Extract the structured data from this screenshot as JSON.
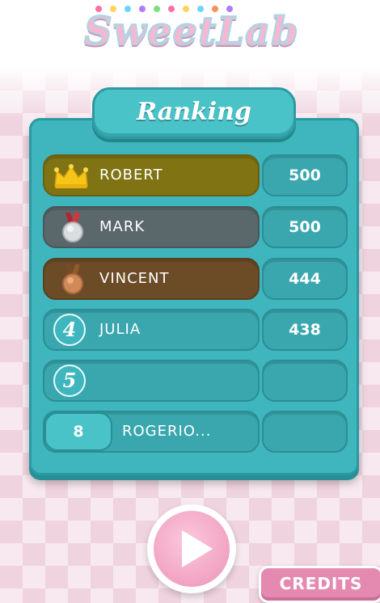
{
  "logo": {
    "text": "SweetLab"
  },
  "ranking": {
    "title": "Ranking",
    "rows": [
      {
        "rank": "1",
        "name": "ROBERT",
        "score": "500",
        "badge": "crown"
      },
      {
        "rank": "2",
        "name": "MARK",
        "score": "500",
        "badge": "silver-medal"
      },
      {
        "rank": "3",
        "name": "VINCENT",
        "score": "444",
        "badge": "bronze-medal"
      },
      {
        "rank": "4",
        "name": "JULIA",
        "score": "438"
      },
      {
        "rank": "5",
        "name": "",
        "score": ""
      }
    ],
    "current_player": {
      "rank": "8",
      "name": "ROGERIO...",
      "score": ""
    }
  },
  "buttons": {
    "play_icon": "play-icon",
    "credits_label": "CREDITS"
  },
  "colors": {
    "board": "#3fb6bd",
    "gold_row": "#7f7314",
    "silver_row": "#5a686c",
    "bronze_row": "#6b4c27",
    "accent_pink": "#e48ab1"
  }
}
